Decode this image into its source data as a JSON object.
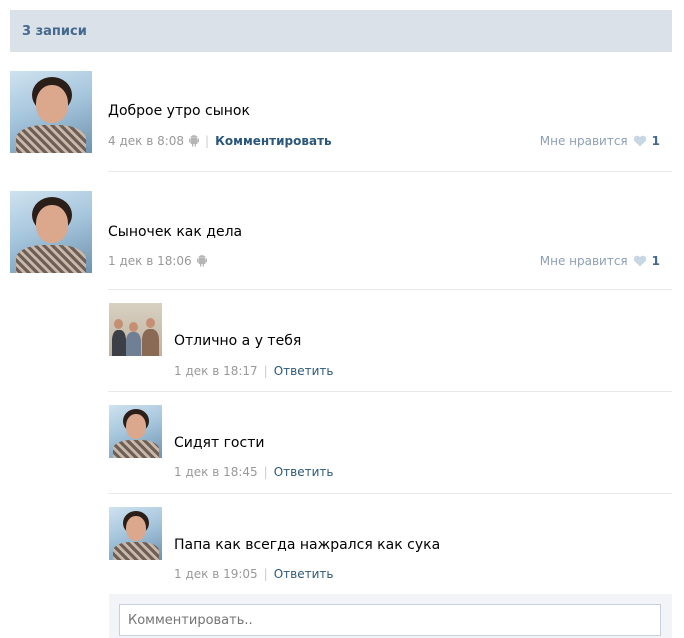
{
  "header": {
    "title": "3 записи"
  },
  "posts": [
    {
      "text": "Доброе утро сынок",
      "time": "4 дек в 8:08",
      "comment_link": "Комментировать",
      "like_label": "Мне нравится",
      "like_count": "1"
    },
    {
      "text": "Сыночек как дела",
      "time": "1 дек в 18:06",
      "like_label": "Мне нравится",
      "like_count": "1"
    }
  ],
  "replies": [
    {
      "text": "Отлично а у тебя",
      "time": "1 дек в 18:17",
      "reply_link": "Ответить"
    },
    {
      "text": "Сидят гости",
      "time": "1 дек в 18:45",
      "reply_link": "Ответить"
    },
    {
      "text": "Папа как всегда нажрался как сука",
      "time": "1 дек в 19:05",
      "reply_link": "Ответить"
    }
  ],
  "comment_box": {
    "placeholder": "Комментировать.."
  },
  "colors": {
    "header_bg": "#dae1e8",
    "link": "#2b587a",
    "muted": "#999999"
  }
}
